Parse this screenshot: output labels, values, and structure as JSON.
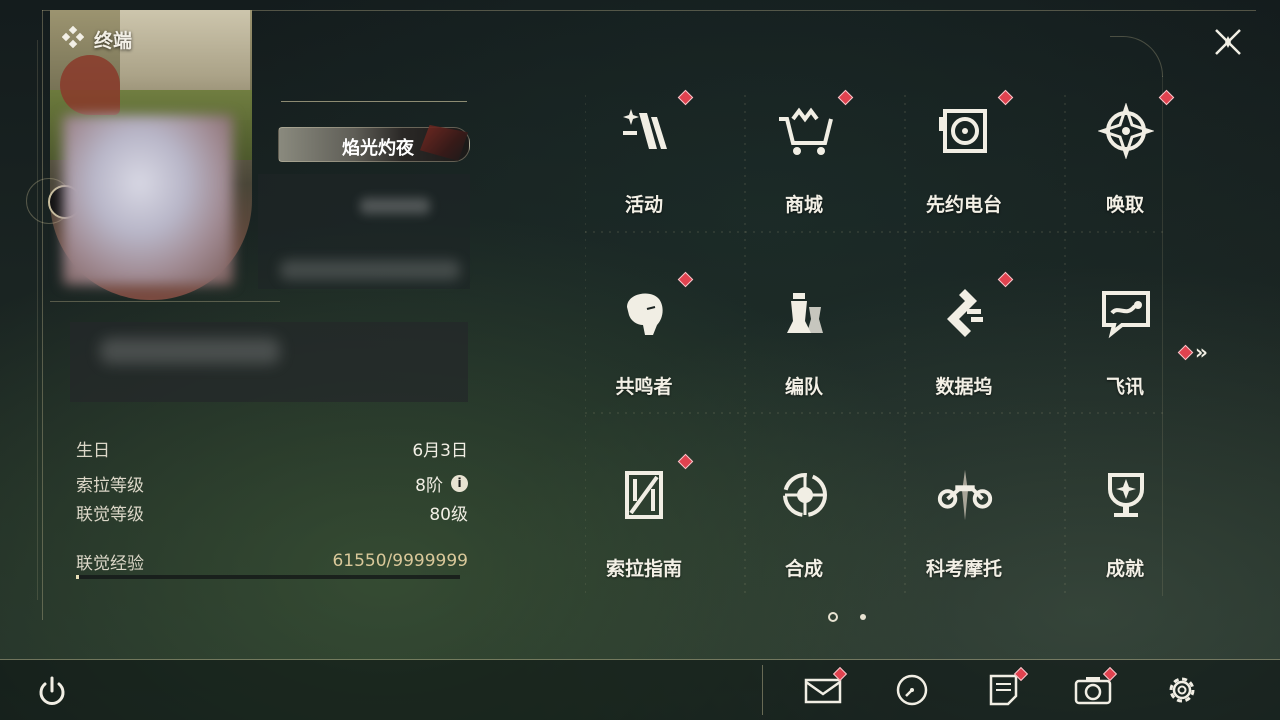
{
  "header": {
    "title": "终端"
  },
  "profile": {
    "title_badge": "焰光灼夜",
    "info": [
      {
        "label": "生日",
        "value": "6月3日"
      },
      {
        "label": "索拉等级",
        "value": "8阶"
      },
      {
        "label": "联觉等级",
        "value": "80级"
      },
      {
        "label": "联觉经验",
        "value": "61550/9999999"
      }
    ],
    "exp_current": 61550,
    "exp_max": 9999999
  },
  "menu": {
    "items": [
      {
        "label": "活动",
        "icon": "activity-icon",
        "alert": true
      },
      {
        "label": "商城",
        "icon": "shop-cart-icon",
        "alert": true
      },
      {
        "label": "先约电台",
        "icon": "radio-icon",
        "alert": true
      },
      {
        "label": "唤取",
        "icon": "convene-icon",
        "alert": true
      },
      {
        "label": "共鸣者",
        "icon": "resonator-icon",
        "alert": true
      },
      {
        "label": "编队",
        "icon": "team-icon",
        "alert": false
      },
      {
        "label": "数据坞",
        "icon": "data-bank-icon",
        "alert": true
      },
      {
        "label": "飞讯",
        "icon": "chat-icon",
        "alert": false
      },
      {
        "label": "索拉指南",
        "icon": "guide-icon",
        "alert": true
      },
      {
        "label": "合成",
        "icon": "synthesis-icon",
        "alert": false
      },
      {
        "label": "科考摩托",
        "icon": "motorcycle-icon",
        "alert": false
      },
      {
        "label": "成就",
        "icon": "trophy-icon",
        "alert": false
      }
    ],
    "next_page_icon": "double-chevron-right-icon",
    "current_page": 1,
    "page_count": 2
  },
  "bottom_bar": {
    "power_icon": "power-icon",
    "buttons": [
      {
        "icon": "mail-icon",
        "alert": true
      },
      {
        "icon": "clock-icon",
        "alert": false
      },
      {
        "icon": "notes-icon",
        "alert": true
      },
      {
        "icon": "camera-icon",
        "alert": true
      },
      {
        "icon": "gear-icon",
        "alert": false
      }
    ]
  },
  "colors": {
    "accent_gold": "#d9c89a",
    "alert_red": "#e0424f",
    "text": "#f3f0e6"
  }
}
